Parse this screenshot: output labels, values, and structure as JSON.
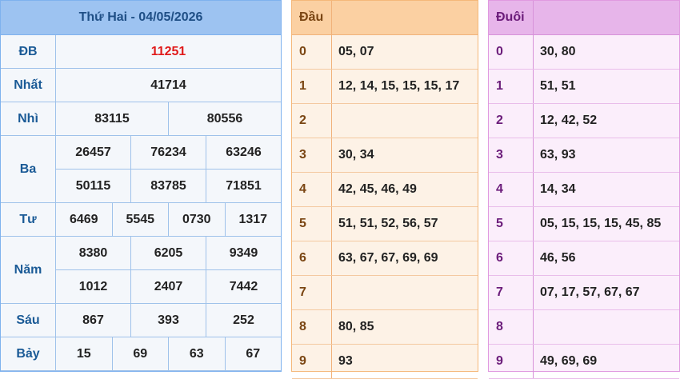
{
  "results": {
    "header": "Thứ Hai - 04/05/2026",
    "prizes": [
      {
        "label": "ĐB",
        "lines": [
          [
            "11251"
          ]
        ],
        "special": true
      },
      {
        "label": "Nhất",
        "lines": [
          [
            "41714"
          ]
        ]
      },
      {
        "label": "Nhì",
        "lines": [
          [
            "83115",
            "80556"
          ]
        ]
      },
      {
        "label": "Ba",
        "lines": [
          [
            "26457",
            "76234",
            "63246"
          ],
          [
            "50115",
            "83785",
            "71851"
          ]
        ]
      },
      {
        "label": "Tư",
        "lines": [
          [
            "6469",
            "5545",
            "0730",
            "1317"
          ]
        ]
      },
      {
        "label": "Năm",
        "lines": [
          [
            "8380",
            "6205",
            "9349"
          ],
          [
            "1012",
            "2407",
            "7442"
          ]
        ]
      },
      {
        "label": "Sáu",
        "lines": [
          [
            "867",
            "393",
            "252"
          ]
        ]
      },
      {
        "label": "Bảy",
        "lines": [
          [
            "15",
            "69",
            "63",
            "67"
          ]
        ]
      }
    ]
  },
  "dau": {
    "header": "Đầu",
    "rows": [
      {
        "key": "0",
        "values": "05, 07"
      },
      {
        "key": "1",
        "values": "12, 14, 15, 15, 15, 17"
      },
      {
        "key": "2",
        "values": ""
      },
      {
        "key": "3",
        "values": "30, 34"
      },
      {
        "key": "4",
        "values": "42, 45, 46, 49"
      },
      {
        "key": "5",
        "values": "51, 51, 52, 56, 57"
      },
      {
        "key": "6",
        "values": "63, 67, 67, 69, 69"
      },
      {
        "key": "7",
        "values": ""
      },
      {
        "key": "8",
        "values": "80, 85"
      },
      {
        "key": "9",
        "values": "93"
      }
    ]
  },
  "duoi": {
    "header": "Đuôi",
    "rows": [
      {
        "key": "0",
        "values": "30, 80"
      },
      {
        "key": "1",
        "values": "51, 51"
      },
      {
        "key": "2",
        "values": "12, 42, 52"
      },
      {
        "key": "3",
        "values": "63, 93"
      },
      {
        "key": "4",
        "values": "14, 34"
      },
      {
        "key": "5",
        "values": "05, 15, 15, 15, 45, 85"
      },
      {
        "key": "6",
        "values": "46, 56"
      },
      {
        "key": "7",
        "values": "07, 17, 57, 67, 67"
      },
      {
        "key": "8",
        "values": ""
      },
      {
        "key": "9",
        "values": "49, 69, 69"
      }
    ]
  }
}
